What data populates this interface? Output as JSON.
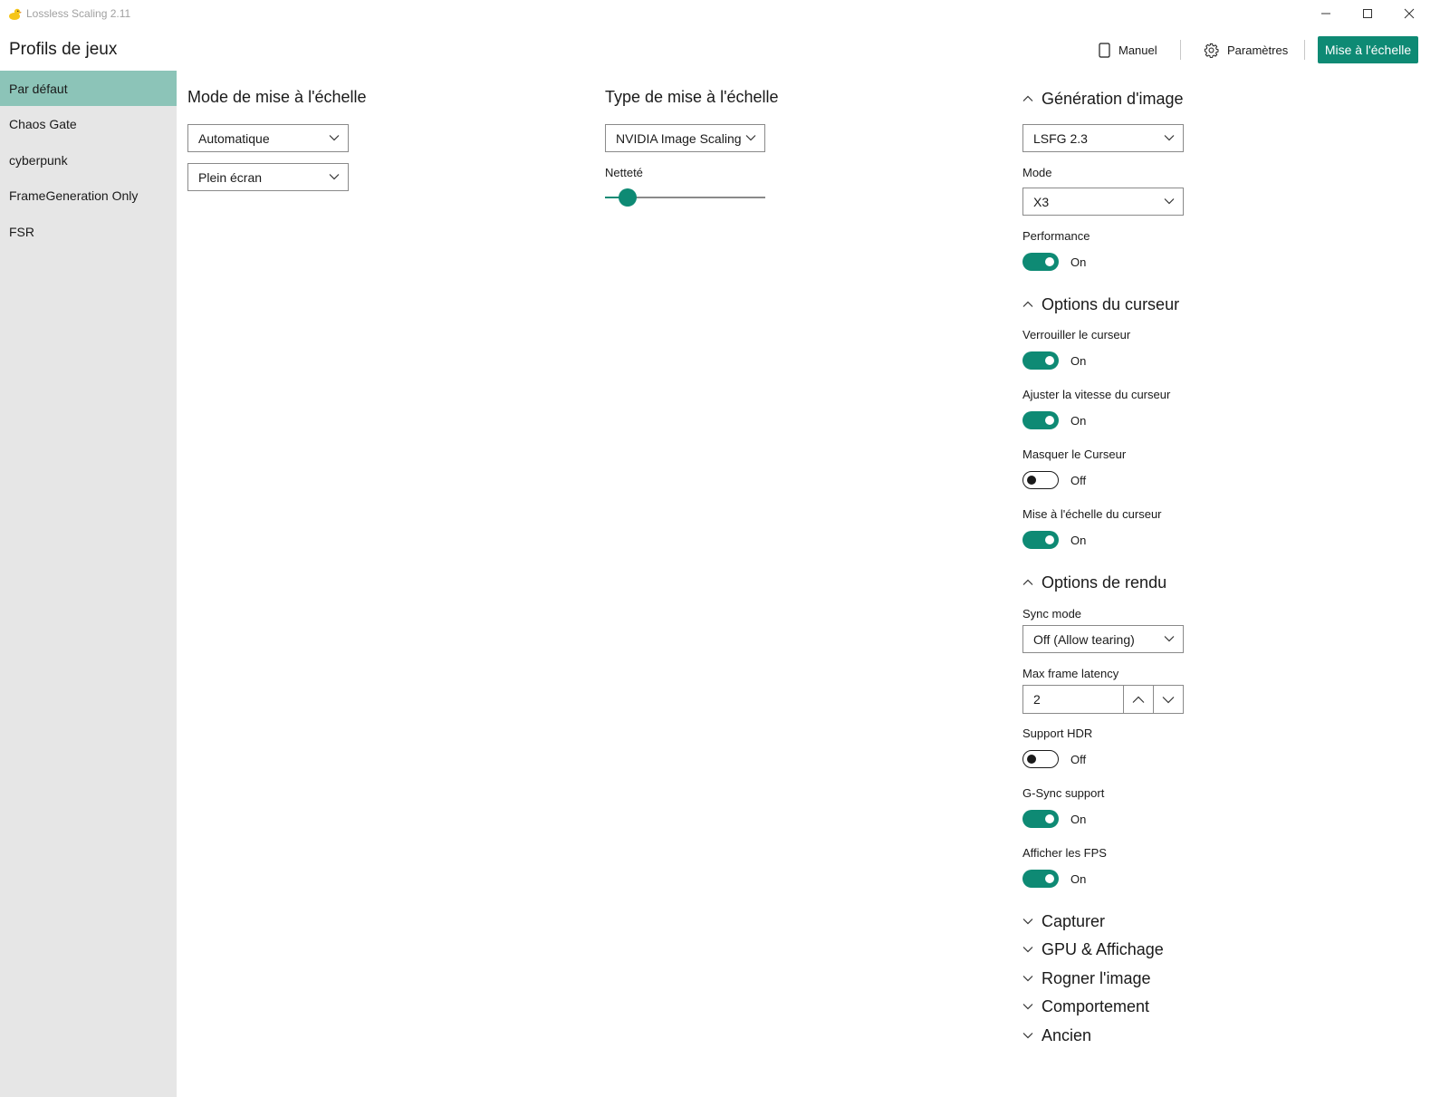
{
  "window": {
    "title": "Lossless Scaling 2.11"
  },
  "header": {
    "profiles_title": "Profils de jeux",
    "manual_label": "Manuel",
    "settings_label": "Paramètres",
    "scale_button_label": "Mise à l'échelle"
  },
  "sidebar": {
    "items": [
      {
        "label": "Par défaut",
        "active": true
      },
      {
        "label": "Chaos Gate"
      },
      {
        "label": "cyberpunk"
      },
      {
        "label": "FrameGeneration Only"
      },
      {
        "label": "FSR"
      }
    ]
  },
  "scaling_mode": {
    "title": "Mode de mise à l'échelle",
    "mode_value": "Automatique",
    "screen_value": "Plein écran"
  },
  "scaling_type": {
    "title": "Type de mise à l'échelle",
    "type_value": "NVIDIA Image Scaling",
    "sharpness_label": "Netteté",
    "sharpness_level": 0.14
  },
  "frame_gen": {
    "title": "Génération d'image",
    "version_value": "LSFG 2.3",
    "mode_label": "Mode",
    "mode_value": "X3",
    "performance_label": "Performance",
    "performance_state": "On"
  },
  "cursor_options": {
    "title": "Options du curseur",
    "lock_label": "Verrouiller le curseur",
    "lock_state": "On",
    "speed_label": "Ajuster la vitesse du curseur",
    "speed_state": "On",
    "hide_label": "Masquer le Curseur",
    "hide_state": "Off",
    "scale_label": "Mise à l'échelle du curseur",
    "scale_state": "On"
  },
  "render_options": {
    "title": "Options de rendu",
    "sync_label": "Sync mode",
    "sync_value": "Off (Allow tearing)",
    "latency_label": "Max frame latency",
    "latency_value": "2",
    "hdr_label": "Support HDR",
    "hdr_state": "Off",
    "gsync_label": "G-Sync support",
    "gsync_state": "On",
    "fps_label": "Afficher les FPS",
    "fps_state": "On"
  },
  "collapsed_sections": [
    "Capturer",
    "GPU & Affichage",
    "Rogner l'image",
    "Comportement",
    "Ancien"
  ],
  "colors": {
    "accent": "#0e8a74",
    "sidebar_bg": "#e6e6e6",
    "sidebar_active": "#8cc4b8"
  }
}
